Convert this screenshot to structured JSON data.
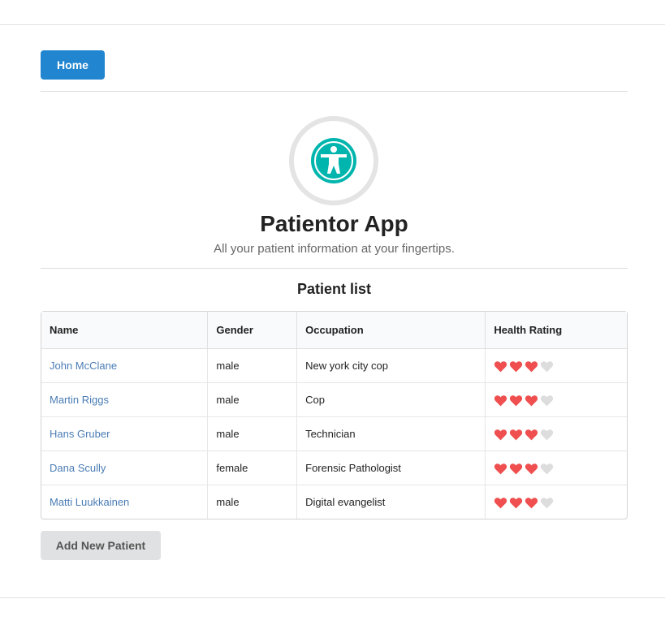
{
  "nav": {
    "home_label": "Home"
  },
  "header": {
    "title": "Patientor App",
    "subtitle": "All your patient information at your fingertips."
  },
  "patients": {
    "title": "Patient list",
    "columns": [
      "Name",
      "Gender",
      "Occupation",
      "Health Rating"
    ],
    "rows": [
      {
        "name": "John McClane",
        "gender": "male",
        "occupation": "New york city cop",
        "rating": 3
      },
      {
        "name": "Martin Riggs",
        "gender": "male",
        "occupation": "Cop",
        "rating": 3
      },
      {
        "name": "Hans Gruber",
        "gender": "male",
        "occupation": "Technician",
        "rating": 3
      },
      {
        "name": "Dana Scully",
        "gender": "female",
        "occupation": "Forensic Pathologist",
        "rating": 3
      },
      {
        "name": "Matti Luukkainen",
        "gender": "male",
        "occupation": "Digital evangelist",
        "rating": 3
      }
    ],
    "rating_max": 4
  },
  "actions": {
    "add_label": "Add New Patient"
  },
  "colors": {
    "primary": "#2185d0",
    "logo": "#00b5ad",
    "heart_active": "#ef4f4f",
    "heart_inactive": "#dddddd"
  },
  "icons": {
    "logo": "universal-access-icon",
    "rating": "heart-icon"
  }
}
